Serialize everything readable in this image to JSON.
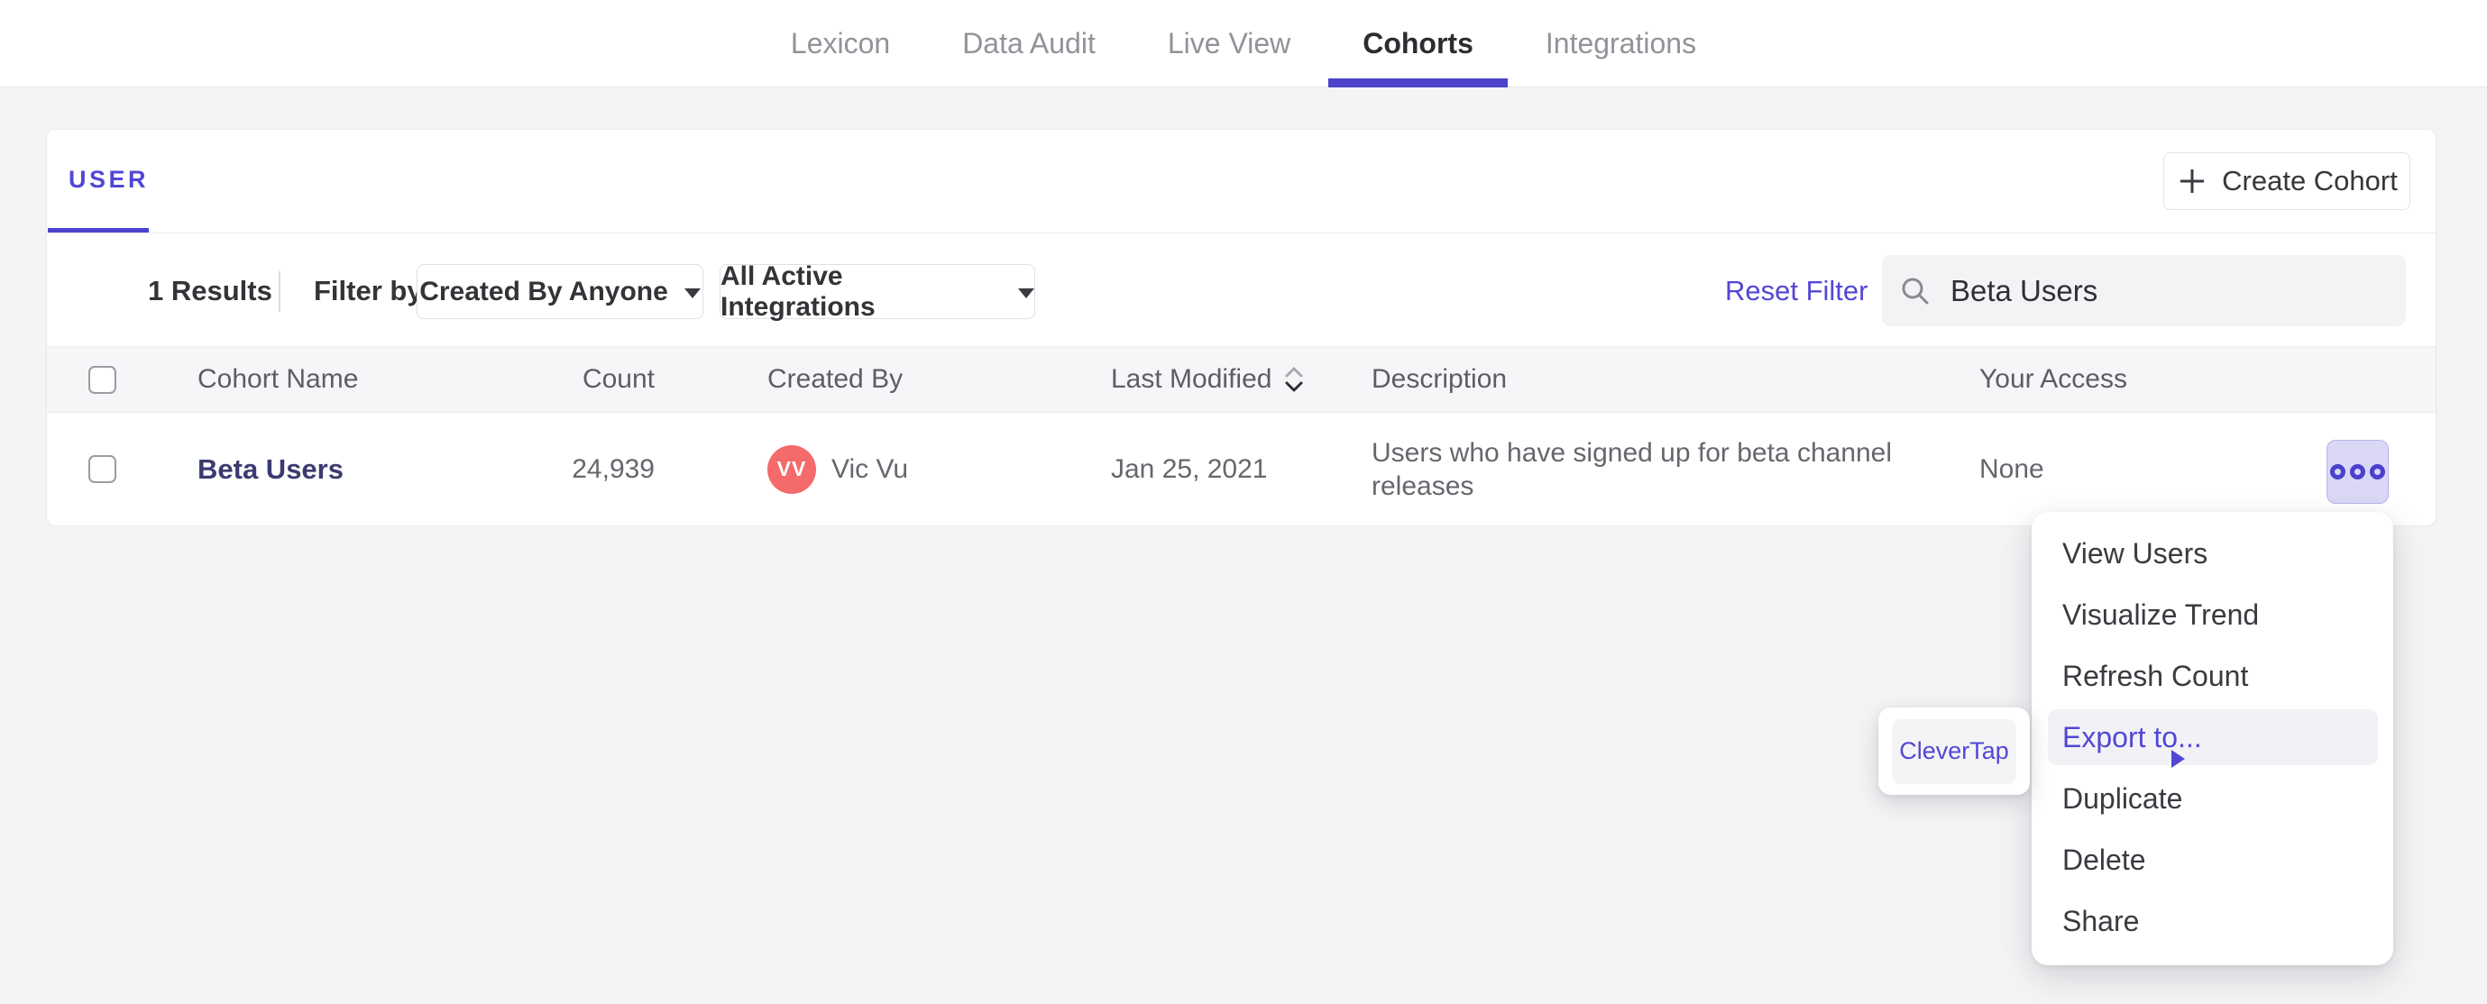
{
  "nav": {
    "tabs": [
      {
        "label": "Lexicon",
        "active": false
      },
      {
        "label": "Data Audit",
        "active": false
      },
      {
        "label": "Live View",
        "active": false
      },
      {
        "label": "Cohorts",
        "active": true
      },
      {
        "label": "Integrations",
        "active": false
      }
    ]
  },
  "panel": {
    "active_tab": "USER",
    "create_button_label": "Create Cohort",
    "filter_bar": {
      "results_count": "1 Results",
      "filter_by_label": "Filter by",
      "created_by_filter": "Created By Anyone",
      "integrations_filter": "All Active Integrations",
      "reset_filter_label": "Reset Filter",
      "search_value": "Beta Users"
    },
    "table": {
      "headers": {
        "cohort_name": "Cohort Name",
        "count": "Count",
        "created_by": "Created By",
        "last_modified": "Last Modified",
        "description": "Description",
        "your_access": "Your Access"
      },
      "row": {
        "name": "Beta Users",
        "count": "24,939",
        "avatar_initials": "VV",
        "created_by": "Vic Vu",
        "last_modified": "Jan 25, 2021",
        "description": "Users who have signed up for beta channel releases",
        "access": "None"
      }
    }
  },
  "context_menu": {
    "items": [
      {
        "label": "View Users"
      },
      {
        "label": "Visualize Trend"
      },
      {
        "label": "Refresh Count"
      },
      {
        "label": "Export to...",
        "highlighted": true,
        "has_submenu": true
      },
      {
        "label": "Duplicate"
      },
      {
        "label": "Delete"
      },
      {
        "label": "Share"
      }
    ],
    "submenu": {
      "items": [
        {
          "label": "CleverTap"
        }
      ]
    }
  },
  "colors": {
    "accent_purple": "#4c43cb",
    "link_purple": "#5247d4",
    "cohort_link_text": "#3b3b72",
    "avatar_red": "#f56a6a",
    "actions_button_bg": "#dad8f4",
    "page_background": "#f4f4f5"
  }
}
